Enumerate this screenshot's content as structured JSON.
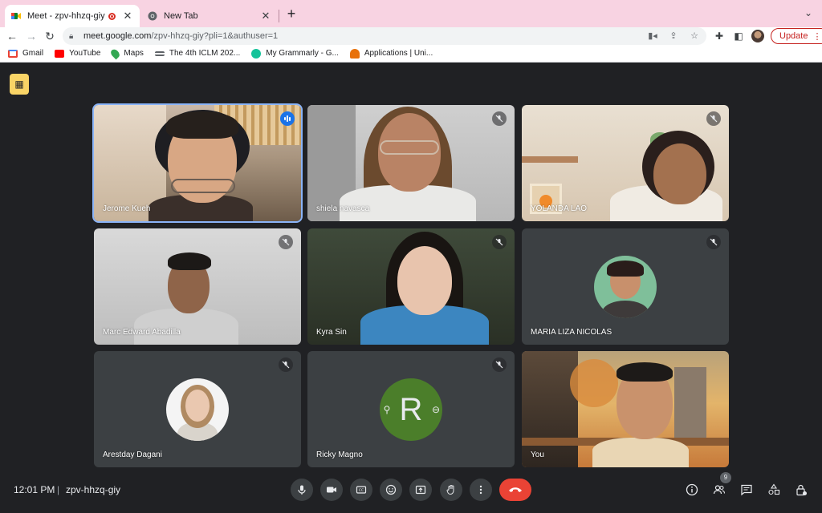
{
  "browser": {
    "tabs": [
      {
        "title": "Meet - zpv-hhzq-giy",
        "active": true,
        "favicon": "google-meet-icon",
        "recording": true
      },
      {
        "title": "New Tab",
        "active": false,
        "favicon": "chrome-icon"
      }
    ],
    "url_host": "meet.google.com",
    "url_path": "/zpv-hhzq-giy?pli=1&authuser=1",
    "update_label": "Update",
    "bookmarks": [
      {
        "label": "Gmail",
        "icon": "gmail-icon",
        "color": "#ea4335"
      },
      {
        "label": "YouTube",
        "icon": "youtube-icon",
        "color": "#ff0000"
      },
      {
        "label": "Maps",
        "icon": "maps-icon",
        "color": "#34a853"
      },
      {
        "label": "The 4th ICLM 202...",
        "icon": "iclm-icon",
        "color": "#5f6368"
      },
      {
        "label": "My Grammarly - G...",
        "icon": "grammarly-icon",
        "color": "#15c39a"
      },
      {
        "label": "Applications | Uni...",
        "icon": "applications-icon",
        "color": "#e8710a"
      }
    ]
  },
  "meet": {
    "accent": "#8ab4f8",
    "participants": [
      {
        "name": "Jerome Kueh",
        "speaking": true
      },
      {
        "name": "shiela navasca",
        "muted": true
      },
      {
        "name": "YOLANDA LAO",
        "muted": true
      },
      {
        "name": "Marc Edward Abadilla",
        "muted": true
      },
      {
        "name": "Kyra Sin",
        "muted": true
      },
      {
        "name": "MARIA LIZA NICOLAS",
        "muted": true
      },
      {
        "name": "Arestday Dagani",
        "muted": true
      },
      {
        "name": "Ricky Magno",
        "muted": true,
        "avatar_letter": "R"
      },
      {
        "name": "You"
      }
    ],
    "time": "12:01 PM",
    "separator": "|",
    "meeting_code": "zpv-hhzq-giy",
    "participant_count": "9"
  }
}
